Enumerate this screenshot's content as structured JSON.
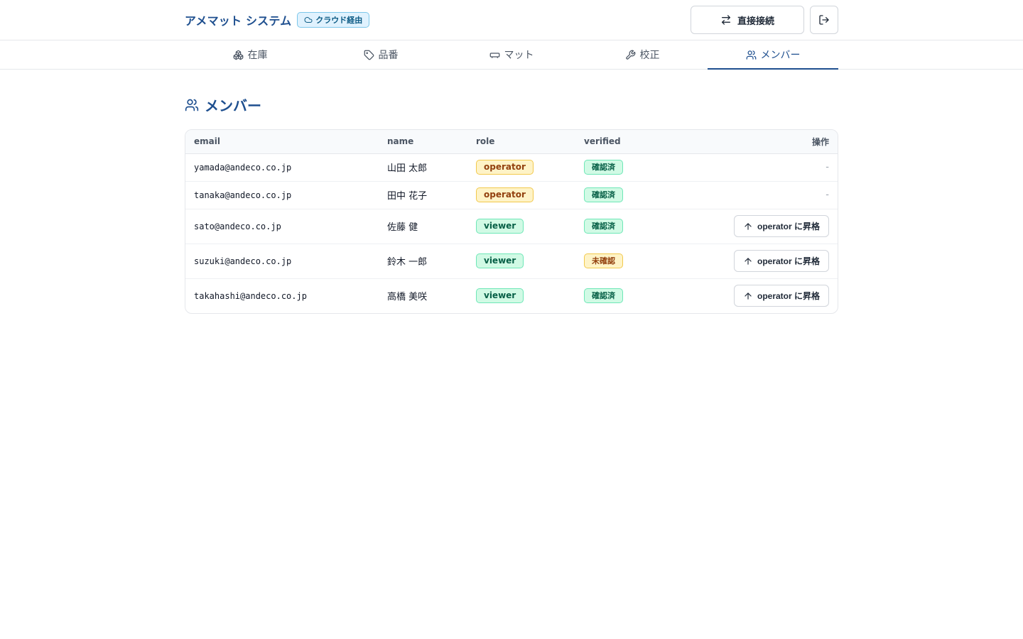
{
  "header": {
    "title": "アメマット システム",
    "badge": "クラウド経由",
    "direct_label": "直接接続"
  },
  "tabs": [
    {
      "label": "在庫",
      "icon": "boxes-icon"
    },
    {
      "label": "品番",
      "icon": "tag-icon"
    },
    {
      "label": "マット",
      "icon": "mat-icon"
    },
    {
      "label": "校正",
      "icon": "wrench-icon"
    },
    {
      "label": "メンバー",
      "icon": "users-icon",
      "active": true
    }
  ],
  "page": {
    "title": "メンバー"
  },
  "table": {
    "headers": {
      "email": "email",
      "name": "name",
      "role": "role",
      "verified": "verified",
      "ops": "操作"
    },
    "promote_label": "operator に昇格",
    "rows": [
      {
        "email": "yamada@andeco.co.jp",
        "name": "山田 太郎",
        "role": "operator",
        "verified": "確認済",
        "verified_ok": true,
        "action": "-"
      },
      {
        "email": "tanaka@andeco.co.jp",
        "name": "田中 花子",
        "role": "operator",
        "verified": "確認済",
        "verified_ok": true,
        "action": "-"
      },
      {
        "email": "sato@andeco.co.jp",
        "name": "佐藤 健",
        "role": "viewer",
        "verified": "確認済",
        "verified_ok": true,
        "action": "promote"
      },
      {
        "email": "suzuki@andeco.co.jp",
        "name": "鈴木 一郎",
        "role": "viewer",
        "verified": "未確認",
        "verified_ok": false,
        "action": "promote"
      },
      {
        "email": "takahashi@andeco.co.jp",
        "name": "高橋 美咲",
        "role": "viewer",
        "verified": "確認済",
        "verified_ok": true,
        "action": "promote"
      }
    ]
  },
  "colors": {
    "brand": "#1e4f8f",
    "operator_badge": "#fef3c7",
    "viewer_badge": "#d1fae5"
  }
}
